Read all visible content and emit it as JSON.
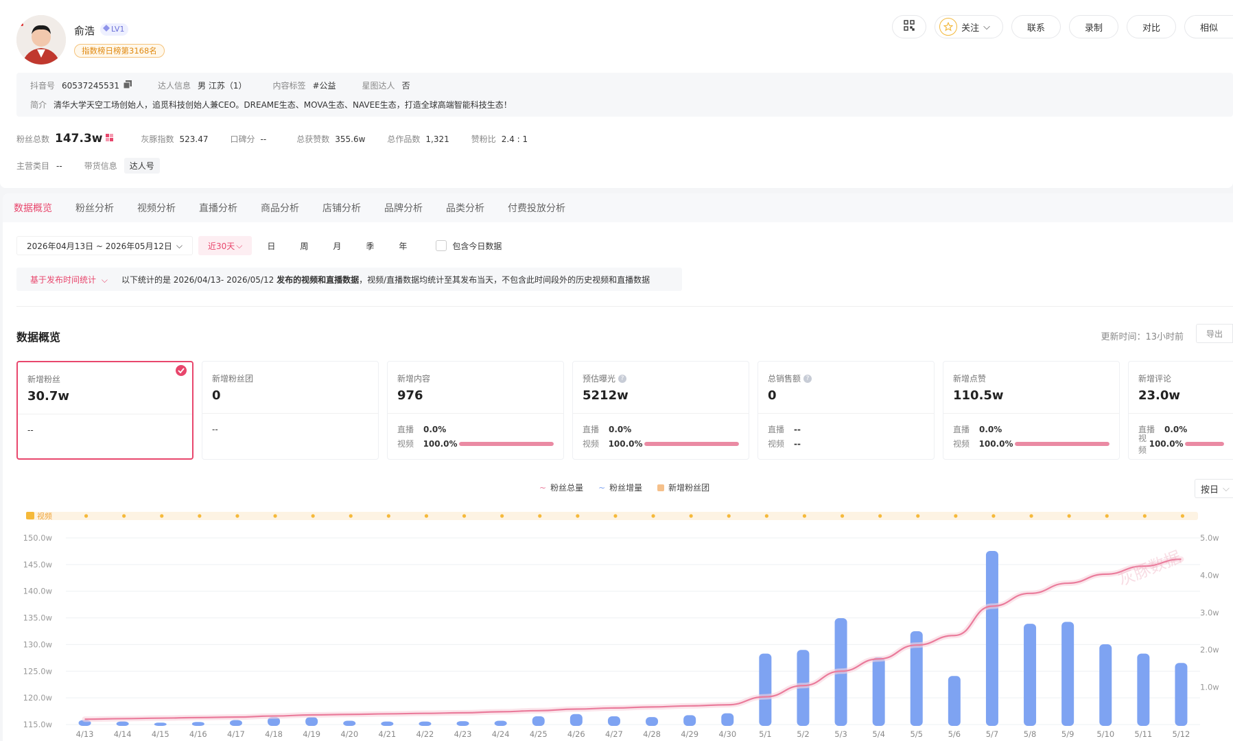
{
  "profile": {
    "name": "俞浩",
    "level": "LV1",
    "rank": "指数榜日榜第3168名"
  },
  "actions": {
    "follow": "关注",
    "contact": "联系",
    "record": "录制",
    "compare": "对比",
    "similar": "相似"
  },
  "info": {
    "douyin_label": "抖音号",
    "douyin_id": "60537245531",
    "talent_label": "达人信息",
    "talent_val": "男 江苏（1）",
    "content_label": "内容标签",
    "content_val": "#公益",
    "star_label": "星图达人",
    "star_val": "否",
    "intro_label": "简介",
    "intro": "清华大学天空工场创始人，追觅科技创始人兼CEO。DREAME生态、MOVA生态、NAVEE生态，打造全球高端智能科技生态！"
  },
  "stats": {
    "fans_label": "粉丝总数",
    "fans": "147.3w",
    "index_label": "灰豚指数",
    "index": "523.47",
    "rep_label": "口碑分",
    "rep": "--",
    "likes_label": "总获赞数",
    "likes": "355.6w",
    "works_label": "总作品数",
    "works": "1,321",
    "ratio_label": "赞粉比",
    "ratio": "2.4 : 1",
    "cat_label": "主营类目",
    "cat": "--",
    "goods_label": "带货信息",
    "goods": "达人号"
  },
  "tabs": [
    "数据概览",
    "粉丝分析",
    "视频分析",
    "直播分析",
    "商品分析",
    "店铺分析",
    "品牌分析",
    "品类分析",
    "付费投放分析"
  ],
  "filter": {
    "date_range": "2026年04月13日 ~ 2026年05月12日",
    "recent": "近30天",
    "periods": [
      "日",
      "周",
      "月",
      "季",
      "年"
    ],
    "include_today": "包含今日数据"
  },
  "notice": {
    "select": "基于发布时间统计",
    "prefix": "以下统计的是 2026/04/13- 2026/05/12 ",
    "bold": "发布的视频和直播数据",
    "suffix": "，视频/直播数据均统计至其发布当天，不包含此时间段外的历史视频和直播数据"
  },
  "overview": {
    "title": "数据概览",
    "update": "更新时间：13小时前",
    "export": "导出"
  },
  "cards": [
    {
      "title": "新增粉丝",
      "value": "30.7w",
      "single": "--"
    },
    {
      "title": "新增粉丝团",
      "value": "0",
      "single": "--"
    },
    {
      "title": "新增内容",
      "value": "976",
      "live": "0.0%",
      "video": "100.0%",
      "video_pct": 100
    },
    {
      "title": "预估曝光",
      "value": "5212w",
      "live": "0.0%",
      "video": "100.0%",
      "video_pct": 100
    },
    {
      "title": "总销售额",
      "value": "0",
      "live": "--",
      "video": "--"
    },
    {
      "title": "新增点赞",
      "value": "110.5w",
      "live": "0.0%",
      "video": "100.0%",
      "video_pct": 100
    },
    {
      "title": "新增评论",
      "value": "23.0w",
      "live": "0.0%",
      "video": "100.0%",
      "video_pct": 100
    }
  ],
  "sub_labels": {
    "live": "直播",
    "video": "视频"
  },
  "legend": {
    "total": "粉丝总量",
    "inc": "粉丝增量",
    "club": "新增粉丝团",
    "byday": "按日"
  },
  "chart_data": {
    "type": "bar",
    "video_track_label": "视频",
    "categories": [
      "4/13",
      "4/14",
      "4/15",
      "4/16",
      "4/17",
      "4/18",
      "4/19",
      "4/20",
      "4/21",
      "4/22",
      "4/23",
      "4/24",
      "4/25",
      "4/26",
      "4/27",
      "4/28",
      "4/29",
      "4/30",
      "5/1",
      "5/2",
      "5/3",
      "5/4",
      "5/5",
      "5/6",
      "5/7",
      "5/8",
      "5/9",
      "5/10",
      "5/11",
      "5/12"
    ],
    "series": [
      {
        "name": "粉丝增量",
        "axis": "right",
        "values": [
          0.12,
          0.08,
          0.05,
          0.07,
          0.12,
          0.2,
          0.2,
          0.1,
          0.08,
          0.08,
          0.09,
          0.1,
          0.22,
          0.28,
          0.22,
          0.2,
          0.25,
          0.3,
          1.9,
          2.0,
          2.85,
          1.8,
          2.5,
          1.3,
          4.65,
          2.7,
          2.75,
          2.15,
          1.9,
          1.65
        ]
      },
      {
        "name": "粉丝总量",
        "axis": "left",
        "values": [
          116.0,
          116.1,
          116.2,
          116.3,
          116.4,
          116.6,
          116.8,
          116.9,
          117.0,
          117.1,
          117.2,
          117.4,
          117.6,
          117.9,
          118.1,
          118.3,
          118.5,
          118.7,
          120.2,
          122.3,
          125.0,
          127.3,
          129.9,
          131.7,
          137.2,
          139.6,
          141.5,
          143.2,
          144.7,
          146.0
        ]
      }
    ],
    "left_axis": {
      "min": 115,
      "max": 150,
      "ticks": [
        "115.0w",
        "120.0w",
        "125.0w",
        "130.0w",
        "135.0w",
        "140.0w",
        "145.0w",
        "150.0w"
      ]
    },
    "right_axis": {
      "min": 0,
      "max": 5,
      "ticks": [
        "",
        "1.0w",
        "2.0w",
        "3.0w",
        "4.0w",
        "5.0w"
      ]
    },
    "colors": {
      "bar": "#7ea3f2",
      "line": "#ea7b9b",
      "video_dot": "#f5b93a",
      "video_track": "#fdf3e3"
    },
    "watermark": "灰豚数据"
  }
}
